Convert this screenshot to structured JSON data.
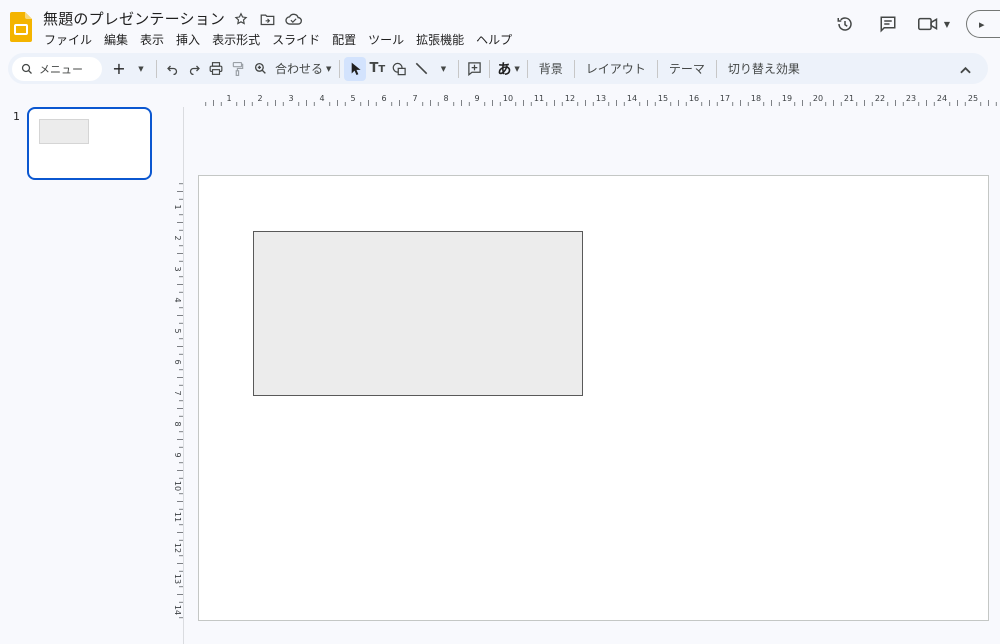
{
  "header": {
    "title": "無題のプレゼンテーション",
    "title_icons": [
      "star-icon",
      "move-to-folder-icon",
      "cloud-saved-icon"
    ],
    "right_icons": [
      "history-icon",
      "comments-icon",
      "meet-camera-icon"
    ]
  },
  "menu": [
    "ファイル",
    "編集",
    "表示",
    "挿入",
    "表示形式",
    "スライド",
    "配置",
    "ツール",
    "拡張機能",
    "ヘルプ"
  ],
  "toolbar": {
    "search_label": "メニュー",
    "zoom_label": "合わせる",
    "input_tool_label": "あ",
    "background_label": "背景",
    "layout_label": "レイアウト",
    "theme_label": "テーマ",
    "transition_label": "切り替え効果"
  },
  "filmstrip": {
    "slides": [
      {
        "number": "1"
      }
    ]
  },
  "ruler": {
    "horizontal_labels": [
      "1",
      "2",
      "3",
      "4",
      "5",
      "6",
      "7",
      "8",
      "9",
      "10",
      "11",
      "12",
      "13",
      "14",
      "15",
      "16",
      "17",
      "18",
      "19",
      "20",
      "21",
      "22",
      "23",
      "24",
      "25"
    ],
    "vertical_labels": [
      "1",
      "2",
      "3",
      "4",
      "5",
      "6",
      "7",
      "8",
      "9",
      "10",
      "11",
      "12",
      "13",
      "14"
    ]
  },
  "colors": {
    "accent": "#0b57d0",
    "slides_yellow": "#f4b400",
    "toolbar_bg": "#edf2fa",
    "shape_fill": "#ececec"
  }
}
